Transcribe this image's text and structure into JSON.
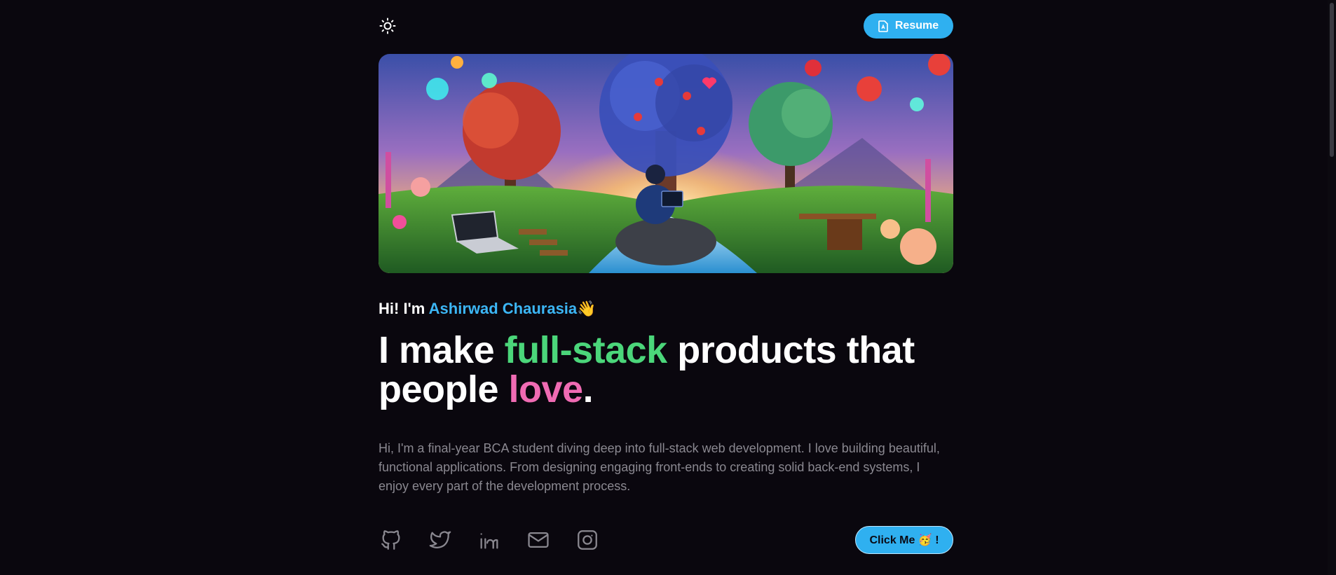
{
  "header": {
    "theme_icon": "sun-icon",
    "resume_label": "Resume",
    "resume_icon": "document-icon"
  },
  "hero": {
    "image_description_icon": "hero-illustration"
  },
  "intro": {
    "greeting_prefix": "Hi! I'm ",
    "name": "Ashirwad Chaurasia",
    "wave": "👋"
  },
  "headline": {
    "part1": "I make ",
    "highlight1": "full-stack",
    "part2": " products that people ",
    "highlight2": "love",
    "part3": "."
  },
  "bio": "Hi, I'm a final-year BCA student diving deep into full-stack web development. I love building beautiful, functional applications. From designing engaging front-ends to creating solid back-end systems, I enjoy every part of the development process.",
  "socials": [
    {
      "icon": "github-icon"
    },
    {
      "icon": "twitter-icon"
    },
    {
      "icon": "linkedin-icon"
    },
    {
      "icon": "mail-icon"
    },
    {
      "icon": "instagram-icon"
    }
  ],
  "cta": {
    "label": "Click Me 🥳 !"
  },
  "colors": {
    "background": "#0a070e",
    "accent": "#2fb0f0",
    "name": "#3cb6f5",
    "green": "#4bd67a",
    "pink": "#f06bb3",
    "muted": "#8a8890"
  }
}
